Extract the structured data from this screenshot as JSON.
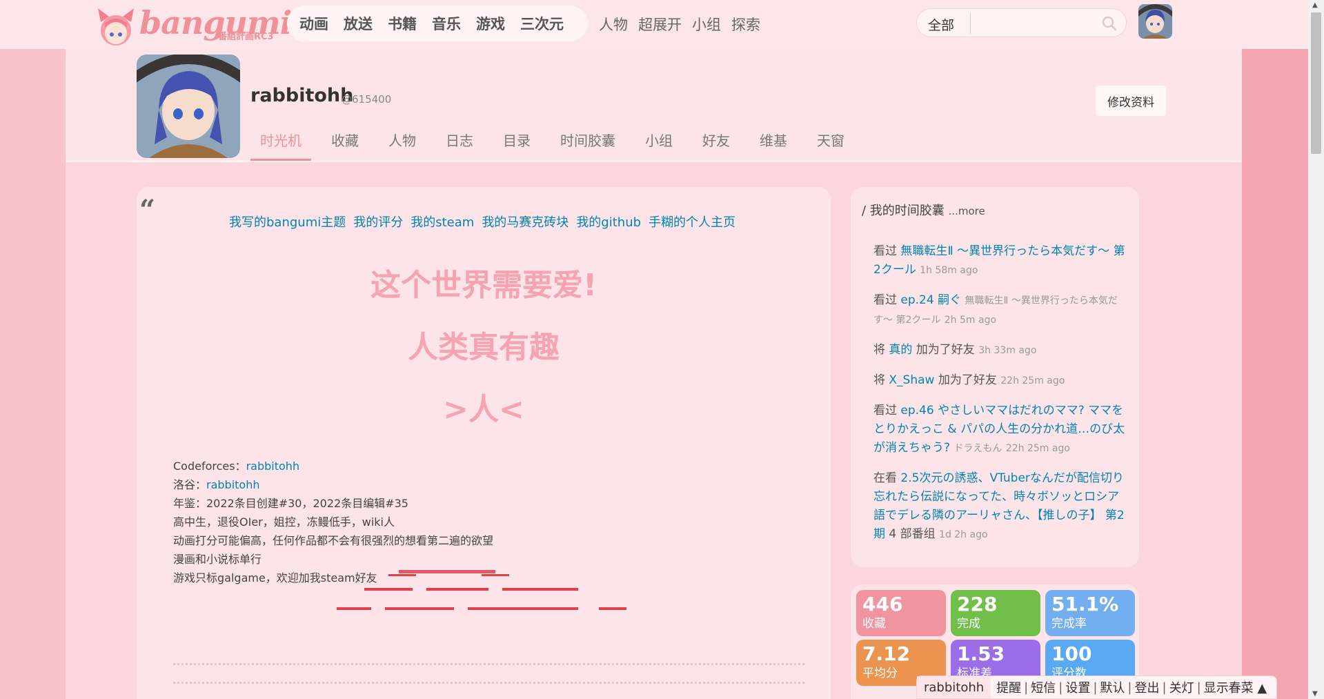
{
  "header": {
    "logo_text": "bangumi",
    "logo_sub": "番組計画RC3",
    "main_nav": [
      "动画",
      "放送",
      "书籍",
      "音乐",
      "游戏",
      "三次元"
    ],
    "sub_nav": [
      "人物",
      "超展开",
      "小组",
      "探索"
    ],
    "search": {
      "scope": "全部",
      "placeholder": ""
    }
  },
  "profile": {
    "username": "rabbitohh",
    "uid": "@615400",
    "edit_label": "修改资料",
    "tabs": [
      "时光机",
      "收藏",
      "人物",
      "日志",
      "目录",
      "时间胶囊",
      "小组",
      "好友",
      "维基",
      "天窗"
    ]
  },
  "intro": {
    "quote_mark": "“",
    "links": [
      "我写的bangumi主题",
      "我的评分",
      "我的steam",
      "我的马赛克砖块",
      "我的github",
      "手糊的个人主页"
    ],
    "big_lines": [
      "这个世界需要爱!",
      "人类真有趣",
      ">人<"
    ],
    "bio": [
      {
        "label": "Codeforces：",
        "value": "rabbitohh"
      },
      {
        "label": "洛谷：",
        "value": "rabbitohh"
      },
      {
        "label": "年鉴：2022条目创建#30，2022条目编辑#35",
        "value": ""
      },
      {
        "label": "高中生，退役OIer，姐控，冻鳗低手，wiki人",
        "value": ""
      },
      {
        "label": "动画打分可能偏高，任何作品都不会有很强烈的想看第二遍的欲望",
        "value": ""
      },
      {
        "label": "漫画和小说标单行",
        "value": ""
      },
      {
        "label": "游戏只标galgame，欢迎加我steam好友",
        "value": ""
      }
    ]
  },
  "timecapsule": {
    "title": "/ 我的时间胶囊",
    "more": "...more",
    "items": [
      {
        "pre": "看过 ",
        "link": "無職転生Ⅱ ～異世界行ったら本気だす～ 第2クール",
        "sub": "",
        "time": "1h 58m ago"
      },
      {
        "pre": "看过 ",
        "link": "ep.24 嗣ぐ",
        "sub": "無職転生Ⅱ ～異世界行ったら本気だす～ 第2クール",
        "time": "2h 5m ago"
      },
      {
        "pre": "将 ",
        "link": "真的",
        "post": " 加为了好友",
        "sub": "",
        "time": "3h 33m ago"
      },
      {
        "pre": "将 ",
        "link": "X_Shaw",
        "post": " 加为了好友",
        "sub": "",
        "time": "22h 25m ago"
      },
      {
        "pre": "看过 ",
        "link": "ep.46 やさしいママはだれのママ? ママをとりかえっこ & パパの人生の分かれ道…のび太が消えちゃう?",
        "sub": "ドラえもん",
        "time": "22h 25m ago"
      },
      {
        "pre": "在看 ",
        "link": "2.5次元の誘惑、VTuberなんだが配信切り忘れたら伝説になってた、時々ボソッとロシア語でデレる隣のアーリャさん、【推しの子】 第2期",
        "post": " 4 部番组",
        "sub": "",
        "time": "1d 2h ago"
      }
    ]
  },
  "stats": [
    {
      "num": "446",
      "label": "收藏",
      "color": "#f0949f"
    },
    {
      "num": "228",
      "label": "完成",
      "color": "#72be4a"
    },
    {
      "num": "51.1%",
      "label": "完成率",
      "color": "#72aef0"
    },
    {
      "num": "7.12",
      "label": "平均分",
      "color": "#eb9450"
    },
    {
      "num": "1.53",
      "label": "标准差",
      "color": "#9b6ee8"
    },
    {
      "num": "100",
      "label": "评分数",
      "color": "#58a8f3"
    }
  ],
  "dock": {
    "user": "rabbitohh",
    "items": [
      "提醒",
      "短信",
      "设置",
      "默认",
      "登出",
      "关灯",
      "显示春菜 ▲"
    ]
  },
  "colors": {
    "accent": "#f09199",
    "link": "#0084b4"
  }
}
